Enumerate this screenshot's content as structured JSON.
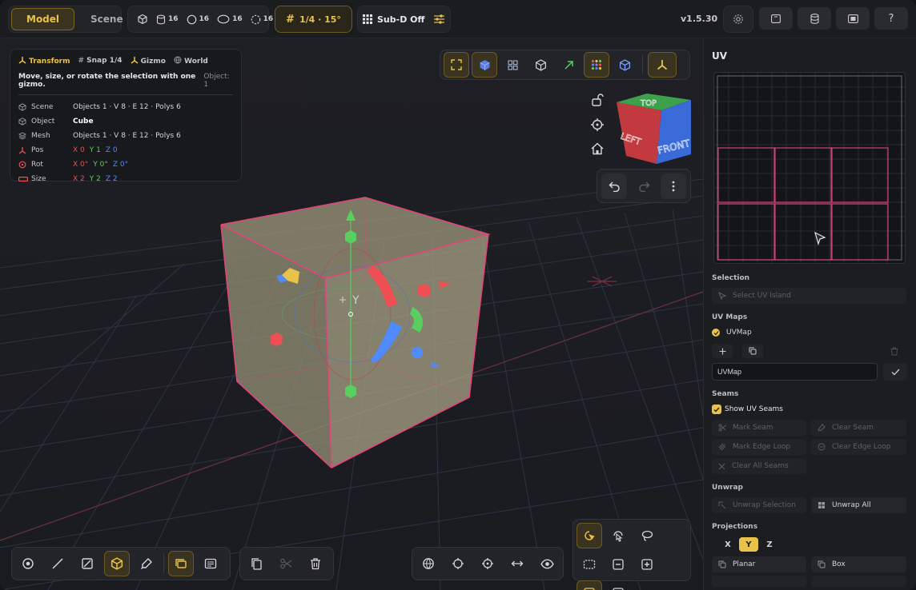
{
  "modes": [
    {
      "label": "Model",
      "active": true
    },
    {
      "label": "Scene",
      "active": false
    }
  ],
  "stats": [
    {
      "icon": "cube-icon",
      "value": ""
    },
    {
      "icon": "cylinder-icon",
      "value": "16"
    },
    {
      "icon": "sphere-icon",
      "value": "16"
    },
    {
      "icon": "torus-icon",
      "value": "16"
    },
    {
      "icon": "circle-dashed-icon",
      "value": "16"
    }
  ],
  "snap_label": "1/4 · 15°",
  "subd_label": "Sub-D",
  "subd_state": "Off",
  "version": "v1.5.30",
  "help_label": "?",
  "info": {
    "header": {
      "transform": "Transform",
      "snap": "Snap 1/4",
      "gizmo": "Gizmo",
      "space": "World"
    },
    "description": "Move, size, or rotate the selection with one gizmo.",
    "object_count": "Object: 1",
    "rows": {
      "scene": {
        "label": "Scene",
        "value": "Objects 1 · V 8 · E 12 · Polys 6"
      },
      "object": {
        "label": "Object",
        "value": "Cube"
      },
      "mesh": {
        "label": "Mesh",
        "value": "Objects 1 · V 8 · E 12 · Polys 6"
      },
      "pos": {
        "label": "Pos",
        "x": "X 0",
        "y": "Y 1",
        "z": "Z 0"
      },
      "rot": {
        "label": "Rot",
        "x": "X 0°",
        "y": "Y 0°",
        "z": "Z 0°"
      },
      "size": {
        "label": "Size",
        "x": "X 2",
        "y": "Y 2",
        "z": "Z 2"
      }
    }
  },
  "nav_cube": {
    "top": "TOP",
    "left": "LEFT",
    "front": "FRONT"
  },
  "gizmo_axis_label": "Y",
  "panel": {
    "title": "UV",
    "selection_title": "Selection",
    "select_uv_island": "Select UV Island",
    "uvmaps_title": "UV Maps",
    "uvmap_name": "UVMap",
    "uvmap_input_value": "UVMap",
    "seams_title": "Seams",
    "show_uv_seams": "Show UV Seams",
    "mark_seam": "Mark Seam",
    "clear_seam": "Clear Seam",
    "mark_edge_loop": "Mark Edge Loop",
    "clear_edge_loop": "Clear Edge Loop",
    "clear_all_seams": "Clear All Seams",
    "unwrap_title": "Unwrap",
    "unwrap_selection": "Unwrap Selection",
    "unwrap_all": "Unwrap All",
    "projections_title": "Projections",
    "axes": [
      "X",
      "Y",
      "Z"
    ],
    "active_axis": "Y",
    "planar": "Planar",
    "box": "Box"
  },
  "colors": {
    "accent": "#e9c24a",
    "seam": "#e0467a",
    "x_axis": "#ef4f53",
    "y_axis": "#58cf5e",
    "z_axis": "#4f8bff"
  }
}
